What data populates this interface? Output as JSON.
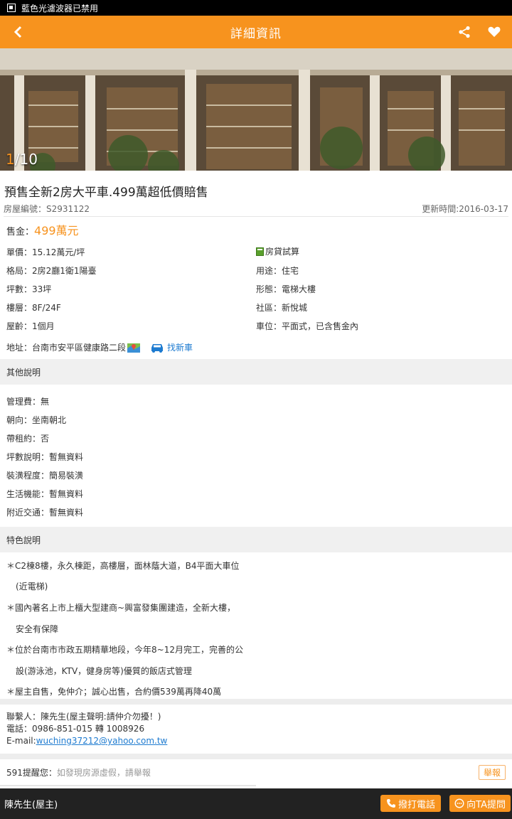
{
  "status_bar": {
    "text": "藍色光濾波器已禁用"
  },
  "app_bar": {
    "title": "詳細資訊",
    "back_icon": "chevron-left-icon",
    "share_icon": "share-icon",
    "favorite_icon": "heart-icon"
  },
  "gallery": {
    "current": "1",
    "total": "/10"
  },
  "listing": {
    "title": "預售全新2房大平車.499萬超低價賠售",
    "id_text": "房屋編號：S2931122",
    "updated_text": "更新時間:2016-03-17",
    "price_label": "售金：",
    "price_value": "499萬元",
    "unit_price": "單價：15.12萬元/坪",
    "loan_calc": "房貸試算",
    "layout": "格局：2房2廳1衛1陽臺",
    "usage": "用途：住宅",
    "area": "坪數：33坪",
    "form": "形態：電梯大樓",
    "floor": "樓層：8F/24F",
    "community": "社區：新悅城",
    "age": "屋齡：1個月",
    "parking": "車位：平面式，已含售金內",
    "address": "地址：台南市安平區健康路二段",
    "find_car": "找新車"
  },
  "other_info": {
    "header": "其他說明",
    "items": [
      "管理費：無",
      "朝向：坐南朝北",
      "帶租約：否",
      "坪數說明：暫無資料",
      "裝潢程度：簡易裝潢",
      "生活機能：暫無資料",
      "附近交通：暫無資料"
    ]
  },
  "features": {
    "header": "特色說明",
    "lines": [
      "＊C2棟8樓，永久棟距，高樓層，面林蔭大道，B4平面大車位",
      "(近電梯)",
      "＊國內著名上市上櫃大型建商~興富發集團建造，全新大樓，",
      "安全有保障",
      "＊位於台南市市政五期精華地段，今年8~12月完工，完善的公",
      "設(游泳池，KTV，健身房等)優質的飯店式管理",
      "＊屋主自售，免仲介；誠心出售，合約價539萬再降40萬"
    ]
  },
  "contact": {
    "person": "聯繫人：陳先生(屋主聲明:請仲介勿擾！)",
    "phone": "電話：0986-851-015 轉 1008926",
    "email_label": "E-mail:",
    "email": "wuching37212@yahoo.com.tw"
  },
  "reminder": {
    "label": "591提醒您：",
    "hint": "如發現房源虛假，請舉報",
    "report": "舉報"
  },
  "bottom_bar": {
    "owner": "陳先生(屋主)",
    "call": "撥打電話",
    "ask": "向TA提問"
  },
  "colors": {
    "accent": "#f7931e",
    "link": "#1e7bd0"
  }
}
